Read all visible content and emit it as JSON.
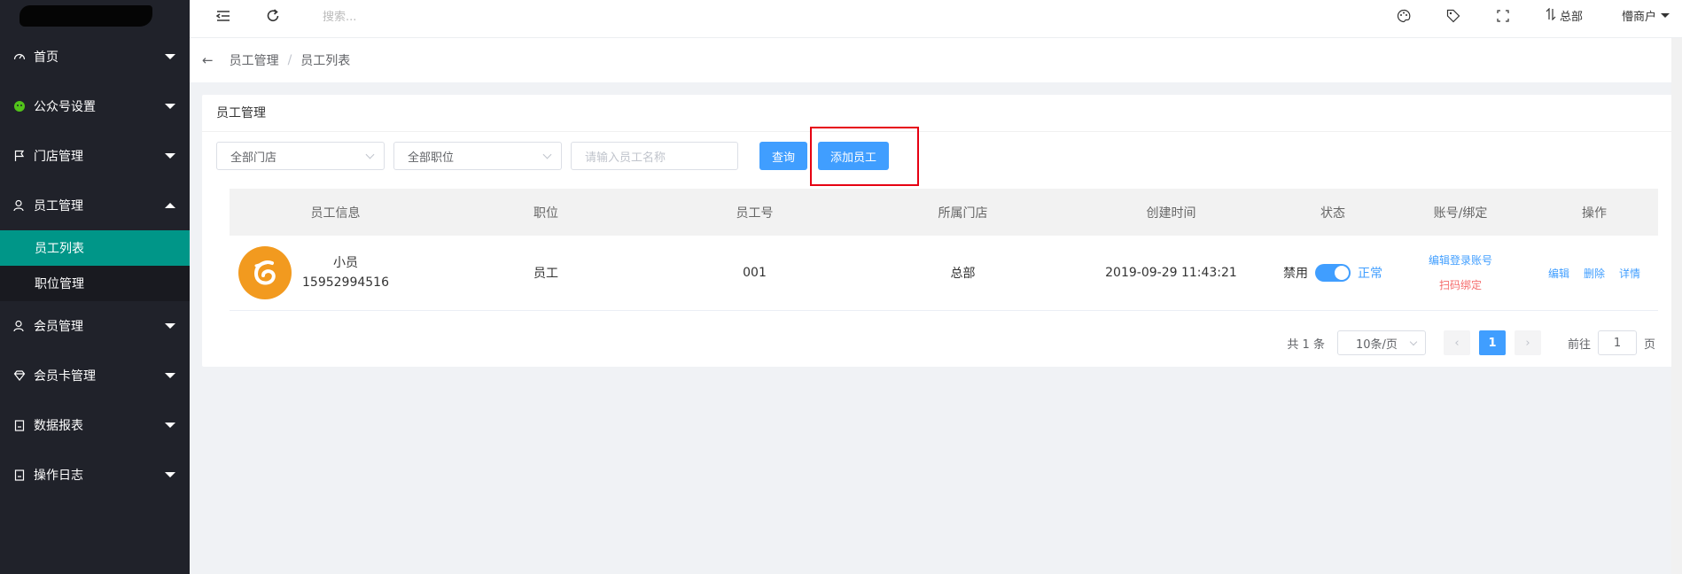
{
  "topbar": {
    "search_placeholder": "搜索...",
    "hq_label": "总部",
    "user_label": "懵商户"
  },
  "sidebar": {
    "items": [
      {
        "label": "首页",
        "icon": "dashboard-icon"
      },
      {
        "label": "公众号设置",
        "icon": "wechat-icon"
      },
      {
        "label": "门店管理",
        "icon": "flag-icon"
      },
      {
        "label": "员工管理",
        "icon": "user-icon",
        "expanded": true
      },
      {
        "label": "会员管理",
        "icon": "user-icon"
      },
      {
        "label": "会员卡管理",
        "icon": "diamond-icon"
      },
      {
        "label": "数据报表",
        "icon": "clipboard-icon"
      },
      {
        "label": "操作日志",
        "icon": "clipboard-icon"
      }
    ],
    "sub_items": [
      {
        "label": "员工列表",
        "active": true
      },
      {
        "label": "职位管理",
        "active": false
      }
    ]
  },
  "breadcrumb": {
    "first": "员工管理",
    "sep": "/",
    "second": "员工列表"
  },
  "card": {
    "title": "员工管理",
    "store_select": "全部门店",
    "position_select": "全部职位",
    "name_placeholder": "请输入员工名称",
    "query_label": "查询",
    "add_label": "添加员工"
  },
  "table": {
    "headers": [
      "员工信息",
      "职位",
      "员工号",
      "所属门店",
      "创建时间",
      "状态",
      "账号/绑定",
      "操作"
    ],
    "rows": [
      {
        "name": "小员",
        "phone": "15952994516",
        "position": "员工",
        "emp_no": "001",
        "store": "总部",
        "created": "2019-09-29 11:43:21",
        "status_off": "禁用",
        "status_on": "正常",
        "account_edit": "编辑登录账号",
        "account_bind": "扫码绑定",
        "op_edit": "编辑",
        "op_delete": "删除",
        "op_detail": "详情"
      }
    ]
  },
  "pagination": {
    "total": "共 1 条",
    "page_size": "10条/页",
    "current": "1",
    "goto_prefix": "前往",
    "goto_value": "1",
    "goto_suffix": "页"
  },
  "colors": {
    "sidebar_bg": "#20222a",
    "active_teal": "#009688",
    "primary_blue": "#409eff",
    "highlight_red": "#e60012",
    "avatar_orange": "#f29a1f"
  }
}
